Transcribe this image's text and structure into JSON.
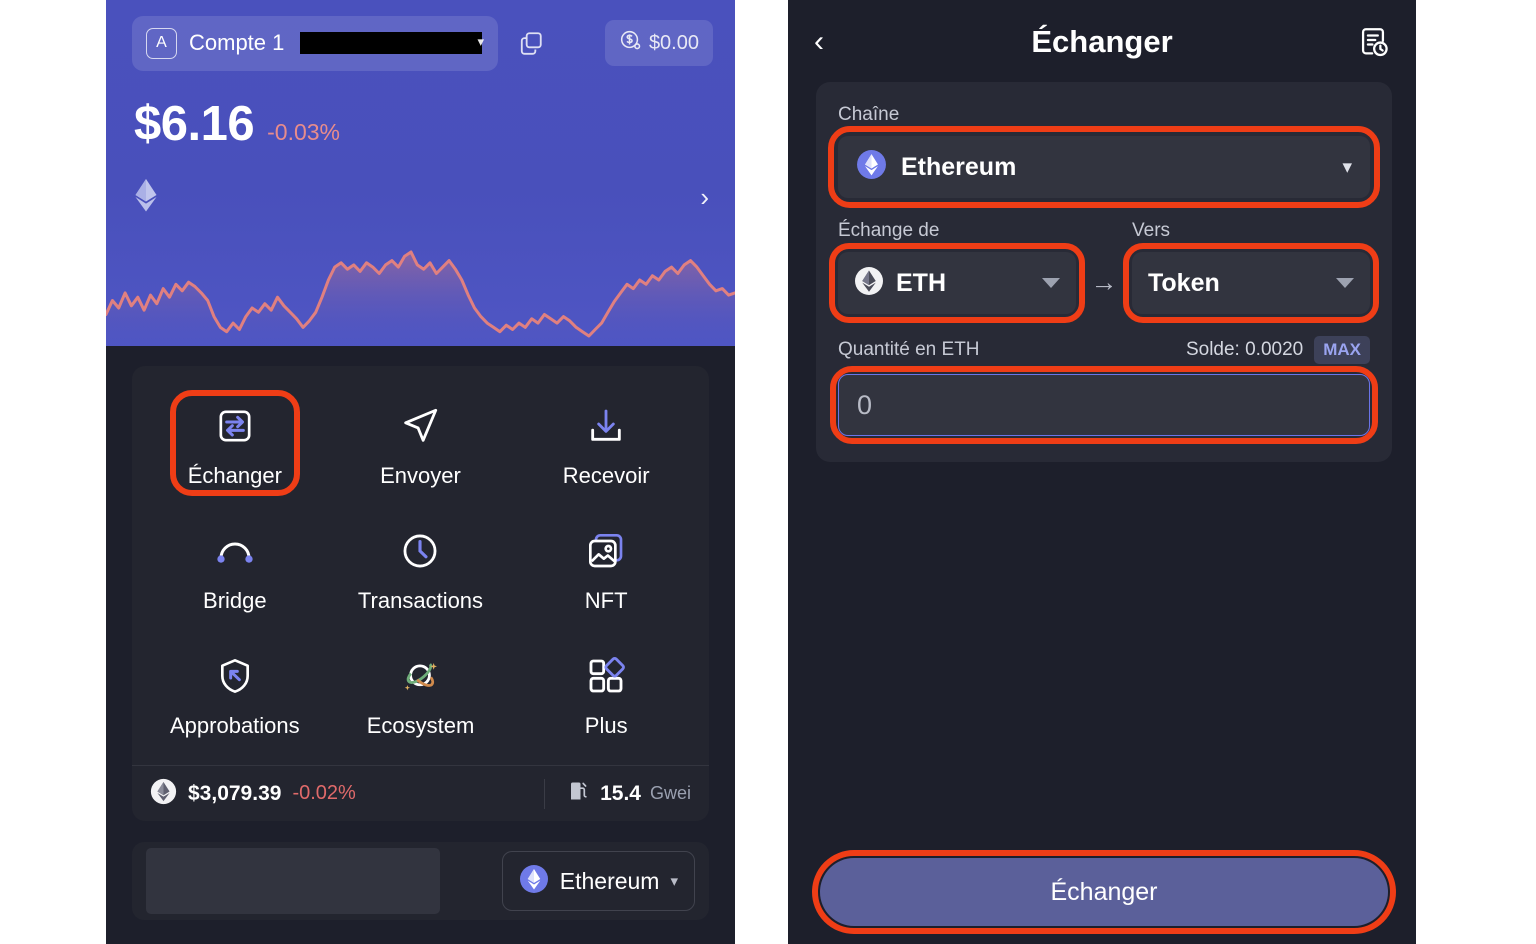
{
  "wallet": {
    "account": {
      "avatar_letter": "A",
      "name": "Compte 1",
      "address_redacted": true
    },
    "copy_icon": "copy-icon",
    "fiat_badge": {
      "icon": "dollar-percent-icon",
      "value": "$0.00"
    },
    "balance": {
      "amount": "$6.16",
      "change": "-0.03%"
    },
    "token_icon": "ethereum-diamond-icon",
    "next_chevron": "chevron-right-icon",
    "chart": {
      "type": "line",
      "title": "Account balance sparkline",
      "line_color": "#e08080",
      "points": [
        42,
        55,
        48,
        62,
        50,
        58,
        46,
        60,
        52,
        66,
        58,
        70,
        64,
        72,
        68,
        62,
        55,
        40,
        30,
        26,
        34,
        28,
        40,
        48,
        44,
        52,
        46,
        58,
        50,
        44,
        38,
        30,
        36,
        44,
        58,
        74,
        86,
        90,
        84,
        88,
        82,
        90,
        86,
        80,
        88,
        92,
        86,
        96,
        100,
        88,
        84,
        90,
        80,
        86,
        92,
        84,
        74,
        60,
        48,
        40,
        34,
        30,
        26,
        32,
        28,
        34,
        30,
        38,
        34,
        42,
        38,
        34,
        40,
        36,
        30,
        26,
        22,
        28,
        34,
        44,
        54,
        62,
        70,
        66,
        74,
        70,
        78,
        74,
        82,
        86,
        80,
        88,
        92,
        86,
        78,
        70,
        64,
        66,
        60,
        62
      ]
    }
  },
  "actions": [
    {
      "id": "swap",
      "label": "Échanger",
      "icon": "swap-icon",
      "highlighted": true
    },
    {
      "id": "send",
      "label": "Envoyer",
      "icon": "send-icon",
      "highlighted": false
    },
    {
      "id": "receive",
      "label": "Recevoir",
      "icon": "receive-icon",
      "highlighted": false
    },
    {
      "id": "bridge",
      "label": "Bridge",
      "icon": "bridge-icon",
      "highlighted": false
    },
    {
      "id": "transactions",
      "label": "Transactions",
      "icon": "clock-icon",
      "highlighted": false
    },
    {
      "id": "nft",
      "label": "NFT",
      "icon": "image-icon",
      "highlighted": false
    },
    {
      "id": "approvals",
      "label": "Approbations",
      "icon": "shield-icon",
      "highlighted": false
    },
    {
      "id": "ecosystem",
      "label": "Ecosystem",
      "icon": "planet-icon",
      "highlighted": false
    },
    {
      "id": "more",
      "label": "Plus",
      "icon": "grid-plus-icon",
      "highlighted": false
    }
  ],
  "price_bar": {
    "token_icon": "ethereum-circle-icon",
    "price": "$3,079.39",
    "change": "-0.02%",
    "gas_icon": "gas-pump-icon",
    "gas_value": "15.4",
    "gas_unit": "Gwei"
  },
  "network_footer": {
    "network_icon": "ethereum-circle-icon",
    "network_name": "Ethereum",
    "caret": "chevron-down-icon"
  },
  "swap": {
    "header": {
      "back_icon": "chevron-left-icon",
      "title": "Échanger",
      "history_icon": "transaction-history-icon"
    },
    "chain": {
      "label": "Chaîne",
      "value": "Ethereum",
      "icon": "ethereum-circle-icon",
      "caret": "chevron-down-icon"
    },
    "from": {
      "label": "Échange de",
      "value": "ETH",
      "icon": "ethereum-circle-icon"
    },
    "arrow_icon": "arrow-right-icon",
    "to": {
      "label": "Vers",
      "value": "Token"
    },
    "quantity": {
      "label": "Quantité en ETH",
      "balance": "Solde: 0.0020",
      "max_label": "MAX",
      "value": "0",
      "placeholder": "0"
    },
    "cta_label": "Échanger"
  },
  "colors": {
    "hero_purple": "#4a51bd",
    "panel_bg": "#1d1f2b",
    "card_bg": "#282a36",
    "field_bg": "#32343f",
    "highlight_red": "#ef3d16",
    "accent_blue": "#6b74e8",
    "negative_red": "#e06a6a",
    "cta_blue": "#5b609a"
  }
}
